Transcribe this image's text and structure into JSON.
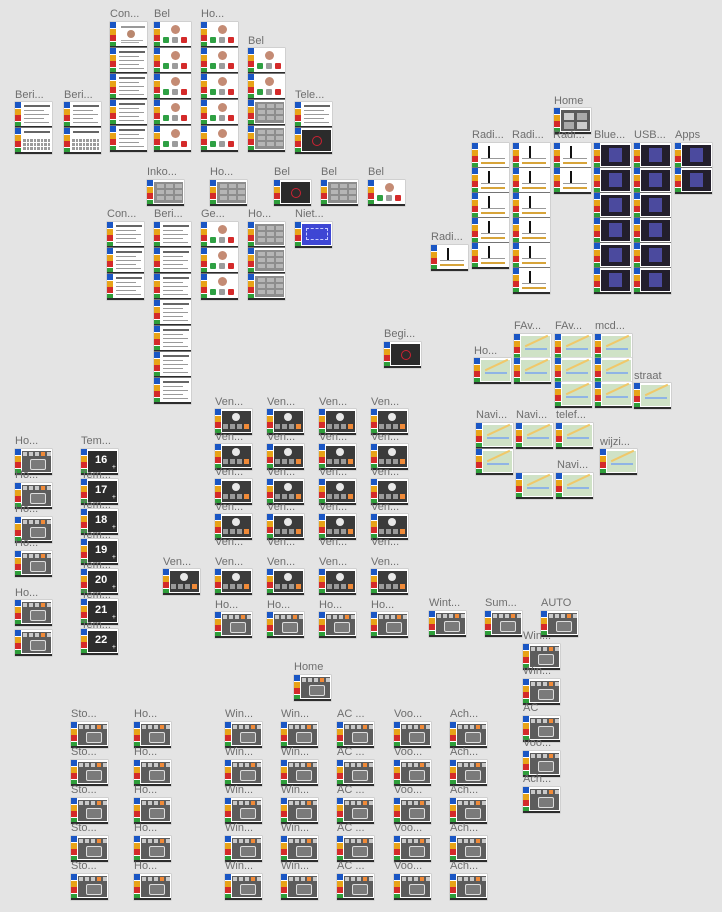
{
  "board": {
    "background": "#e4e4e4"
  },
  "labels": [
    "Con...",
    "Bel",
    "Ho...",
    "Bel",
    "Beri...",
    "Beri...",
    "Tele...",
    "Home",
    "Radi...",
    "Radi...",
    "Radi...",
    "Blue...",
    "USB...",
    "Apps",
    "Inko...",
    "Ho...",
    "Bel",
    "Bel",
    "Bel",
    "Con...",
    "Beri...",
    "Ge...",
    "Ho...",
    "Niet...",
    "Radi...",
    "Begi...",
    "FAv...",
    "FAv...",
    "mcd...",
    "Ho...",
    "straat",
    "Navi...",
    "Navi...",
    "telef...",
    "wijzi...",
    "Navi...",
    "Ven...",
    "Ven...",
    "Ven...",
    "Ven...",
    "Ho...",
    "Tem...",
    "16",
    "17",
    "18",
    "19",
    "20",
    "21",
    "22",
    "Ven...",
    "Ven...",
    "Ven...",
    "Ven...",
    "Ven...",
    "Ho...",
    "Ho...",
    "Ho...",
    "Ho...",
    "Wint...",
    "Sum...",
    "AUTO",
    "Win...",
    "Win...",
    "AC",
    "Voo...",
    "Ach...",
    "Home",
    "Sto...",
    "Ho...",
    "Win...",
    "Win...",
    "AC ...",
    "Voo...",
    "Ach..."
  ],
  "temperatures": [
    "16",
    "17",
    "18",
    "19",
    "20",
    "21",
    "22"
  ],
  "sidebar_colors": [
    "#1a56c4",
    "#e8a317",
    "#d42a2a",
    "#2e9e3a"
  ],
  "frame_types": [
    "contact",
    "call",
    "keypad",
    "list",
    "keyboard",
    "dark",
    "radio",
    "map",
    "app",
    "climate",
    "tempdark",
    "fan",
    "scene",
    "home"
  ]
}
